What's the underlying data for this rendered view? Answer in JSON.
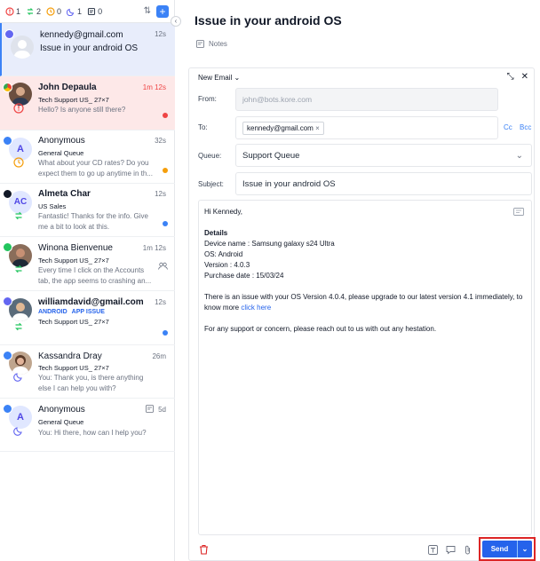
{
  "filters": [
    {
      "count": "1",
      "icon": "alert-icon",
      "color": "#ef4444"
    },
    {
      "count": "2",
      "icon": "transfer-icon",
      "color": "#22c55e"
    },
    {
      "count": "0",
      "icon": "clock-icon",
      "color": "#f59e0b"
    },
    {
      "count": "1",
      "icon": "moon-icon",
      "color": "#6366f1"
    },
    {
      "count": "0",
      "icon": "note-icon",
      "color": "#374151"
    }
  ],
  "conversations": [
    {
      "name": "kennedy@gmail.com",
      "time": "12s",
      "preview": "Issue in your android OS",
      "channel": "email"
    },
    {
      "name": "John Depaula",
      "time": "1m 12s",
      "queue": "Tech Support US_ 27×7",
      "preview": "Hello? Is anyone still there?",
      "channel": "chrome"
    },
    {
      "name": "Anonymous",
      "time": "32s",
      "queue": "General Queue",
      "preview": "What about your CD rates? Do you expect them to go up anytime in th...",
      "channel": "web",
      "initial": "A"
    },
    {
      "name": "Almeta Char",
      "time": "12s",
      "queue": "US Sales",
      "preview": "Fantastic! Thanks for the info. Give me a bit to look at this.",
      "channel": "ios",
      "initial": "AC"
    },
    {
      "name": "Winona Bienvenue",
      "time": "1m 12s",
      "queue": "Tech Support US_ 27×7",
      "preview": "Every time I click on the Accounts tab, the app seems to crashing an...",
      "channel": "whatsapp"
    },
    {
      "name": "williamdavid@gmail.com",
      "time": "12s",
      "tags": [
        "ANDROID",
        "APP ISSUE"
      ],
      "queue": "Tech Support US_ 27×7",
      "channel": "email"
    },
    {
      "name": "Kassandra Dray",
      "time": "26m",
      "queue": "Tech Support US_ 27×7",
      "preview": "You: Thank you, is there anything else I can help you with?",
      "channel": "messenger"
    },
    {
      "name": "Anonymous",
      "time": "5d",
      "queue": "General Queue",
      "preview": "You: Hi there, how can I help you?",
      "channel": "messenger",
      "initial": "A"
    }
  ],
  "header": {
    "title": "Issue in your android OS",
    "notes": "Notes"
  },
  "compose": {
    "mode": "New Email",
    "from_label": "From:",
    "from_placeholder": "john@bots.kore.com",
    "to_label": "To:",
    "to_chip": "kennedy@gmail.com",
    "cc": "Cc",
    "bcc": "Bcc",
    "queue_label": "Queue:",
    "queue_value": "Support Queue",
    "subject_label": "Subject:",
    "subject_value": "Issue in your android OS",
    "body": {
      "greeting": "Hi Kennedy,",
      "details_heading": "Details",
      "device": "Device name : Samsung galaxy s24 Ultra",
      "os": "OS: Android",
      "version": "Version : 4.0.3",
      "purchase": "Purchase date : 15/03/24",
      "paragraph1": "There is an issue with your OS Version 4.0.4, please upgrade to our latest version 4.1 immediately, to know more",
      "link": "click here",
      "paragraph2": "For any support or concern, please reach out to us with out any hestation."
    },
    "send_label": "Send"
  }
}
